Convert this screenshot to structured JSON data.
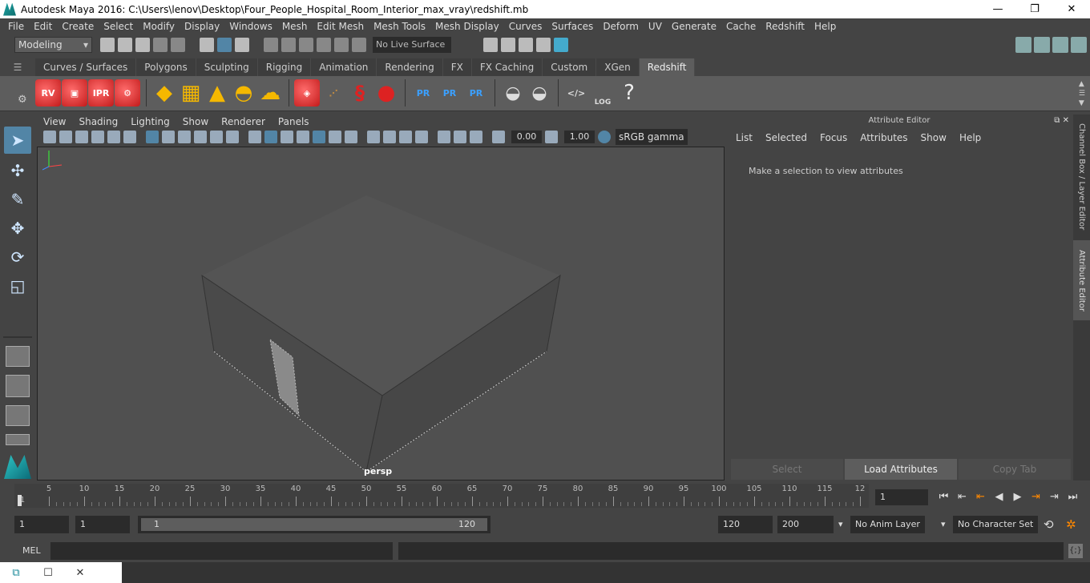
{
  "window": {
    "title": "Autodesk Maya 2016: C:\\Users\\lenov\\Desktop\\Four_People_Hospital_Room_Interior_max_vray\\redshift.mb",
    "minimize": "—",
    "maximize": "❐",
    "close": "✕"
  },
  "menu": [
    "File",
    "Edit",
    "Create",
    "Select",
    "Modify",
    "Display",
    "Windows",
    "Mesh",
    "Edit Mesh",
    "Mesh Tools",
    "Mesh Display",
    "Curves",
    "Surfaces",
    "Deform",
    "UV",
    "Generate",
    "Cache",
    "Redshift",
    "Help"
  ],
  "status_line": {
    "mode": "Modeling",
    "live_surface": "No Live Surface"
  },
  "shelf": {
    "tabs": [
      "Curves / Surfaces",
      "Polygons",
      "Sculpting",
      "Rigging",
      "Animation",
      "Rendering",
      "FX",
      "FX Caching",
      "Custom",
      "XGen",
      "Redshift"
    ],
    "active_tab": "Redshift",
    "items": {
      "rv": "RV",
      "ipr": "IPR",
      "pr1": "PR",
      "pr2": "PR",
      "pr3": "PR",
      "log": "LOG",
      "help": "?"
    }
  },
  "viewport": {
    "menu": [
      "View",
      "Shading",
      "Lighting",
      "Show",
      "Renderer",
      "Panels"
    ],
    "exposure": "0.00",
    "gamma": "1.00",
    "color_space": "sRGB gamma",
    "camera": "persp"
  },
  "attribute_editor": {
    "title": "Attribute Editor",
    "menu": [
      "List",
      "Selected",
      "Focus",
      "Attributes",
      "Show",
      "Help"
    ],
    "message": "Make a selection to view attributes",
    "buttons": {
      "select": "Select",
      "load": "Load Attributes",
      "copy": "Copy Tab"
    },
    "side_tabs": {
      "channel_box": "Channel Box / Layer Editor",
      "attr_editor": "Attribute Editor"
    }
  },
  "timeline": {
    "ticks": [
      "1",
      "5",
      "10",
      "15",
      "20",
      "25",
      "30",
      "35",
      "40",
      "45",
      "50",
      "55",
      "60",
      "65",
      "70",
      "75",
      "80",
      "85",
      "90",
      "95",
      "100",
      "105",
      "110",
      "115",
      "12"
    ],
    "current_frame": "1"
  },
  "range": {
    "start": "1",
    "playback_start": "1",
    "slider_start": "1",
    "slider_end": "120",
    "playback_end": "120",
    "end": "200",
    "anim_layer": "No Anim Layer",
    "character_set": "No Character Set"
  },
  "command_line": {
    "label": "MEL"
  },
  "colors": {
    "background": "#444444",
    "viewport": "#505050",
    "active_tool": "#5285a6",
    "redshift_red": "#d42a2a",
    "accent_yellow": "#f5b800"
  }
}
